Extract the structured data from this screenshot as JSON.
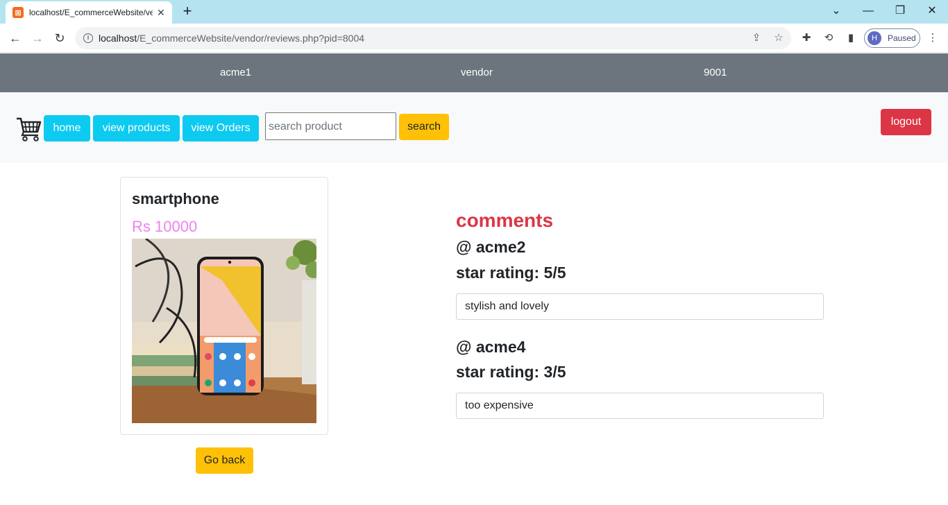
{
  "browser": {
    "tab_title": "localhost/E_commerceWebsite/vendor/reviews.php?pid=8004",
    "url_host": "localhost",
    "url_path": "/E_commerceWebsite/vendor/reviews.php?pid=8004",
    "profile_initial": "H",
    "profile_status": "Paused"
  },
  "infobar": {
    "username": "acme1",
    "role": "vendor",
    "user_id": "9001"
  },
  "nav": {
    "home_label": "home",
    "view_products_label": "view products",
    "view_orders_label": "view Orders",
    "search_placeholder": "search product",
    "search_label": "search",
    "logout_label": "logout"
  },
  "product": {
    "name": "smartphone",
    "price": "Rs 10000",
    "go_back_label": "Go back"
  },
  "comments": {
    "heading": "comments",
    "reviews": [
      {
        "user": "@ acme2",
        "rating": "star rating: 5/5",
        "text": "stylish and lovely"
      },
      {
        "user": "@ acme4",
        "rating": "star rating: 3/5",
        "text": "too expensive"
      }
    ]
  },
  "colors": {
    "info_bar": "#6c757d",
    "btn_info": "#0dcaf0",
    "btn_warning": "#ffc107",
    "btn_danger": "#dc3545",
    "price": "#ee82ee",
    "comments_heading": "#dc3545"
  },
  "icons": [
    "favicon-icon",
    "close-icon",
    "plus-icon",
    "back-icon",
    "forward-icon",
    "reload-icon",
    "info-icon",
    "share-icon",
    "star-icon",
    "extensions-icon",
    "sync-icon",
    "sidepanel-icon",
    "menu-icon",
    "cart-icon"
  ]
}
